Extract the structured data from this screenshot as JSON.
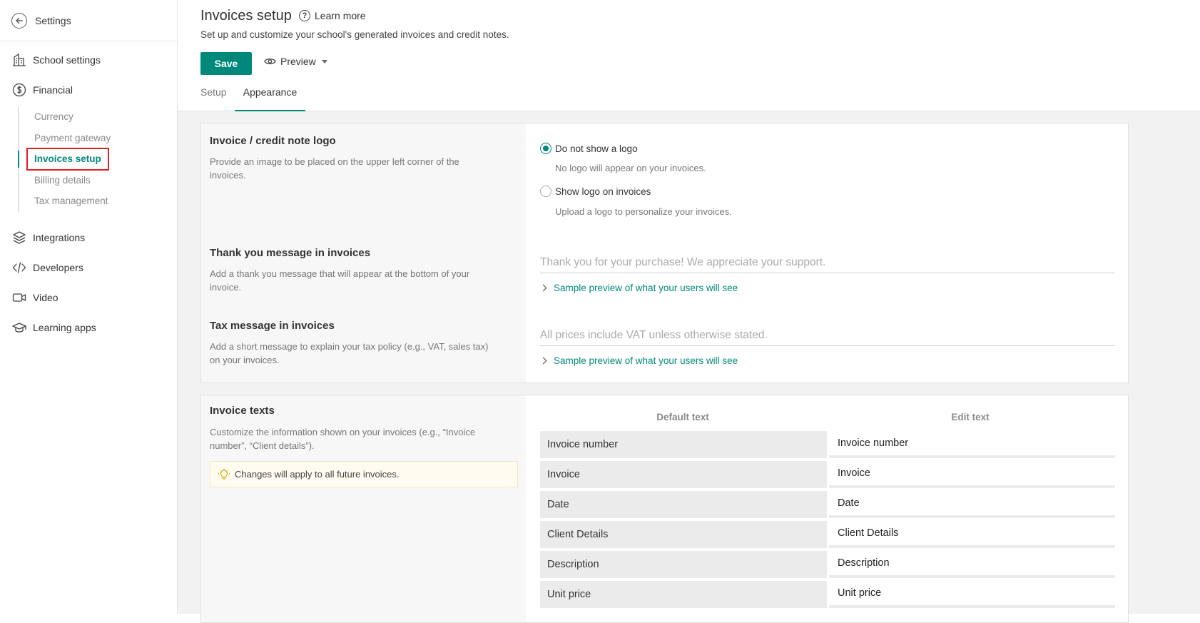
{
  "sidebar": {
    "header": "Settings",
    "items": [
      {
        "label": "School settings",
        "icon": "building-icon"
      },
      {
        "label": "Financial",
        "icon": "dollar-icon"
      },
      {
        "label": "Integrations",
        "icon": "layers-icon"
      },
      {
        "label": "Developers",
        "icon": "code-icon"
      },
      {
        "label": "Video",
        "icon": "video-icon"
      },
      {
        "label": "Learning apps",
        "icon": "graduation-cap-icon"
      }
    ],
    "financial_sub": [
      {
        "label": "Currency"
      },
      {
        "label": "Payment gateway"
      },
      {
        "label": "Invoices setup"
      },
      {
        "label": "Billing details"
      },
      {
        "label": "Tax management"
      }
    ]
  },
  "header": {
    "title": "Invoices setup",
    "learn_more": "Learn more",
    "subtitle": "Set up and customize your school's generated invoices and credit notes.",
    "save": "Save",
    "preview": "Preview"
  },
  "tabs": [
    {
      "label": "Setup"
    },
    {
      "label": "Appearance"
    }
  ],
  "logo_section": {
    "title": "Invoice / credit note logo",
    "desc": "Provide an image to be placed on the upper left corner of the invoices.",
    "options": [
      {
        "label": "Do not show a logo",
        "help": "No logo will appear on your invoices.",
        "checked": true
      },
      {
        "label": "Show logo on invoices",
        "help": "Upload a logo to personalize your invoices.",
        "checked": false
      }
    ]
  },
  "thank_you": {
    "title": "Thank you message in invoices",
    "desc": "Add a thank you message that will appear at the bottom of your invoice.",
    "placeholder": "Thank you for your purchase! We appreciate your support.",
    "sample": "Sample preview of what your users will see"
  },
  "tax_message": {
    "title": "Tax message in invoices",
    "desc": "Add a short message to explain your tax policy (e.g., VAT, sales tax) on your invoices.",
    "placeholder": "All prices include VAT unless otherwise stated.",
    "sample": "Sample preview of what your users will see"
  },
  "invoice_texts": {
    "title": "Invoice texts",
    "desc": "Customize the information shown on your invoices (e.g., “Invoice number”, “Client details”).",
    "notice": "Changes will apply to all future invoices.",
    "col_default": "Default text",
    "col_edit": "Edit text",
    "rows": [
      {
        "default": "Invoice number",
        "edit": "Invoice number"
      },
      {
        "default": "Invoice",
        "edit": "Invoice"
      },
      {
        "default": "Date",
        "edit": "Date"
      },
      {
        "default": "Client Details",
        "edit": "Client Details"
      },
      {
        "default": "Description",
        "edit": "Description"
      },
      {
        "default": "Unit price",
        "edit": "Unit price"
      }
    ]
  },
  "colors": {
    "accent": "#00897b",
    "highlight_border": "#e02020"
  }
}
